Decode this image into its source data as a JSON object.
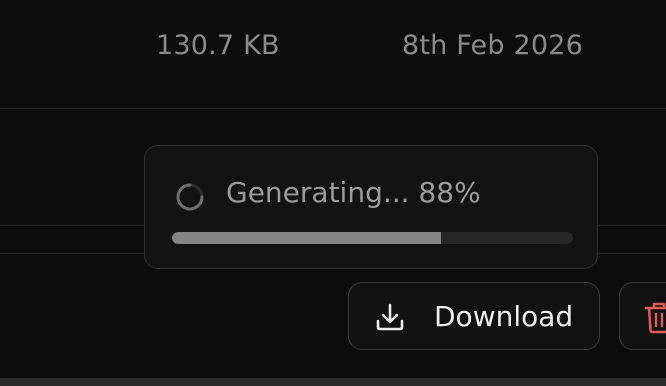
{
  "file": {
    "size": "130.7 KB",
    "date": "8th Feb 2026"
  },
  "generation": {
    "status_text": "Generating... 88%",
    "progress": 0.67,
    "spinner_icon": "spinner-icon"
  },
  "actions": {
    "download_label": "Download",
    "download_icon": "download-icon",
    "delete_icon": "trash-icon"
  },
  "colors": {
    "delete_accent": "#e05a55",
    "progress_fill": "#858585",
    "progress_track": "#262626"
  }
}
